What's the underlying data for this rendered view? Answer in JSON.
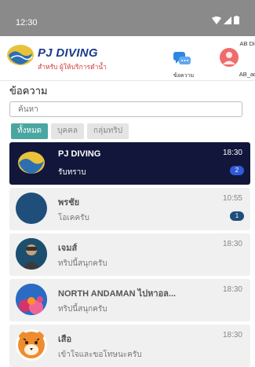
{
  "status": {
    "time": "12:30"
  },
  "header": {
    "brand": "PJ DIVING",
    "tagline": "สำหรับ ผู้ให้บริการดำน้ำ",
    "messages_label": "ข้อความ",
    "account_top": "AB Diving",
    "account_name": "AB_admin"
  },
  "page": {
    "title": "ข้อความ",
    "search_placeholder": "ค้นหา"
  },
  "filters": [
    "ทั้งหมด",
    "บุคคล",
    "กลุ่มทริป"
  ],
  "chats": [
    {
      "name": "PJ DIVING",
      "last": "รับทราบ",
      "time": "18:30",
      "badge": "2",
      "badge_color": "#2f5bd8"
    },
    {
      "name": "พรชัย",
      "last": "โอเคครับ",
      "time": "10:55",
      "badge": "1",
      "badge_color": "#1f4e7a"
    },
    {
      "name": "เจมส์",
      "last": "ทริปนี้สนุกครับ",
      "time": "18:30",
      "badge": "",
      "badge_color": ""
    },
    {
      "name": "NORTH ANDAMAN ไปหาอล...",
      "last": "ทริปนี้สนุกครับ",
      "time": "18:30",
      "badge": "",
      "badge_color": ""
    },
    {
      "name": "เสือ",
      "last": "เข้าใจและขอโทษนะครับ",
      "time": "18:30",
      "badge": "",
      "badge_color": ""
    }
  ],
  "colors": {
    "accent": "#4aa6a0",
    "active_row": "#12163a",
    "status_bar": "#8a8a8a"
  }
}
